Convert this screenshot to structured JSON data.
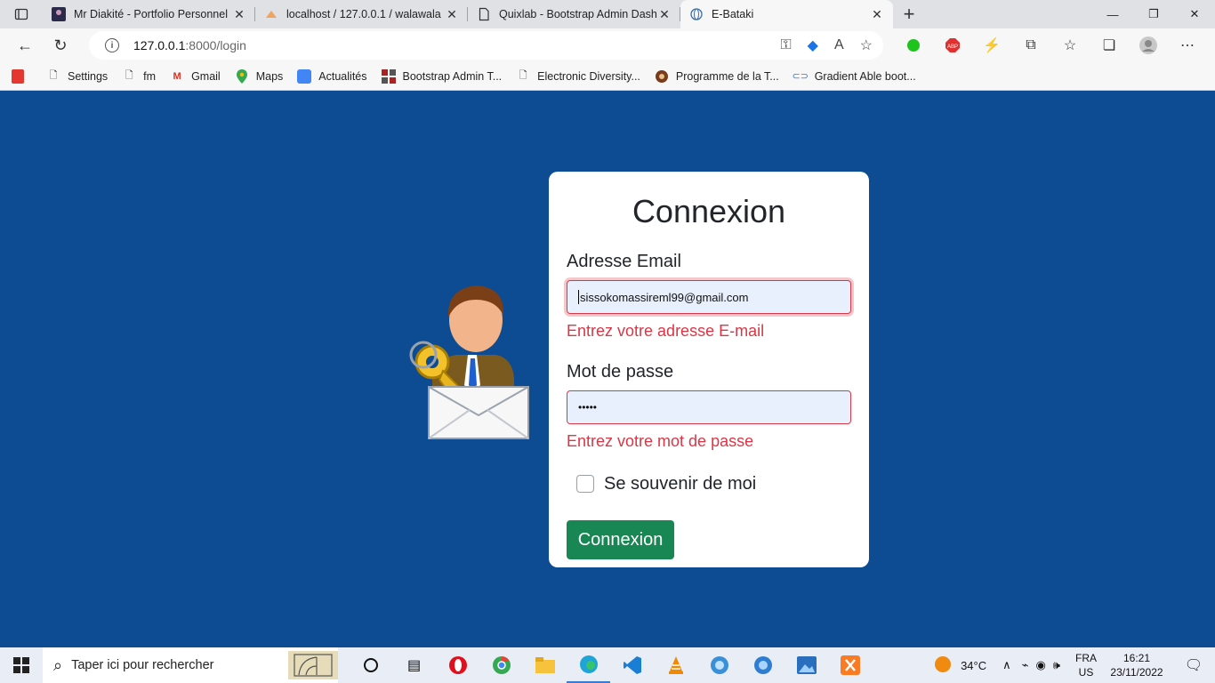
{
  "browser": {
    "tabs": [
      {
        "title": "Mr Diakité - Portfolio Personnel",
        "active": false
      },
      {
        "title": "localhost / 127.0.0.1 / walawala |",
        "active": false
      },
      {
        "title": "Quixlab - Bootstrap Admin Dashb",
        "active": false
      },
      {
        "title": "E-Bataki",
        "active": true
      }
    ],
    "url_host": "127.0.0.1",
    "url_path": ":8000/login",
    "bookmarks": [
      "Settings",
      "fm",
      "Gmail",
      "Maps",
      "Actualités",
      "Bootstrap Admin T...",
      "Electronic Diversity...",
      "Programme de la T...",
      "Gradient Able boot..."
    ]
  },
  "login": {
    "heading": "Connexion",
    "email_label": "Adresse Email",
    "email_value": "sissokomassireml99@gmail.com",
    "email_error": "Entrez votre adresse E-mail",
    "password_label": "Mot de passe",
    "password_value": "•••••",
    "password_error": "Entrez votre mot de passe",
    "remember_label": "Se souvenir de moi",
    "submit_label": "Connexion"
  },
  "taskbar": {
    "search_placeholder": "Taper ici pour rechercher",
    "weather": "34°C",
    "lang_top": "FRA",
    "lang_bottom": "US",
    "time": "16:21",
    "date": "23/11/2022"
  },
  "colors": {
    "page_bg": "#0d4b92",
    "error": "#dc3545",
    "submit": "#198754"
  }
}
